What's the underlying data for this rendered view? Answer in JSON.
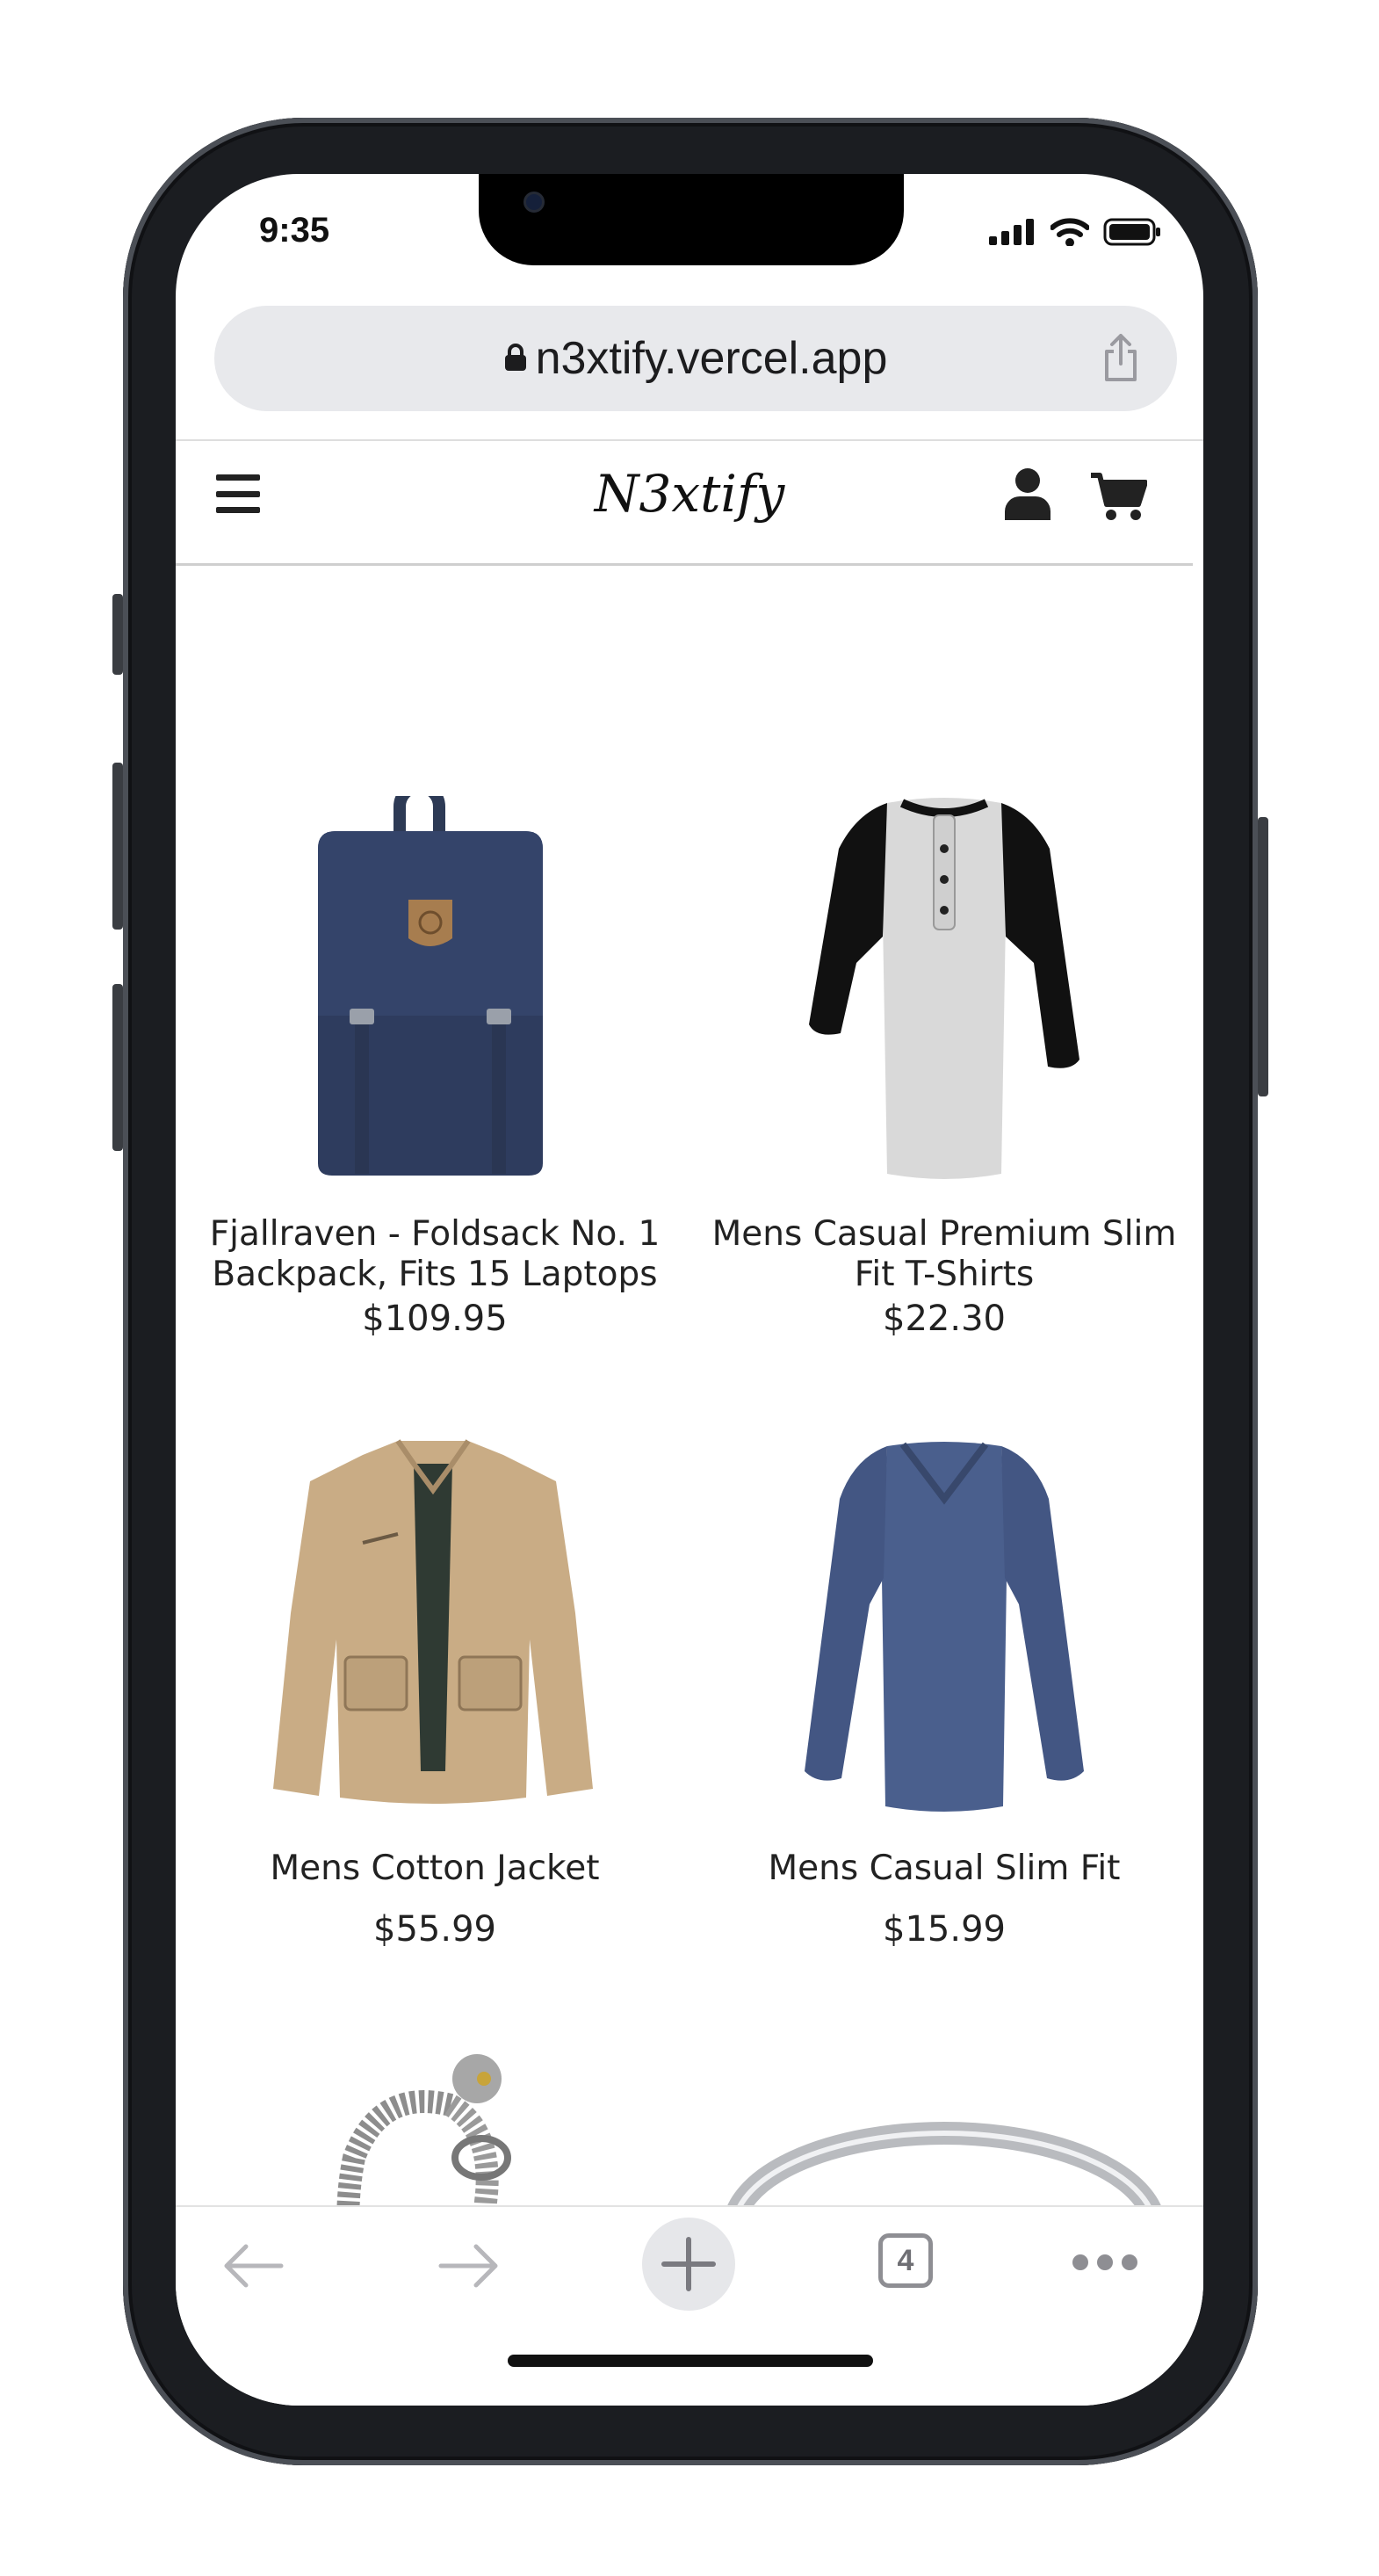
{
  "status": {
    "time": "9:35"
  },
  "browser": {
    "url": "n3xtify.vercel.app",
    "tab_count": "4"
  },
  "site": {
    "logo": "N3xtify"
  },
  "products": [
    {
      "title": "Fjallraven - Foldsack No. 1 Backpack, Fits 15 Laptops",
      "price": "$109.95",
      "image": "backpack"
    },
    {
      "title": "Mens Casual Premium Slim Fit T-Shirts",
      "price": "$22.30",
      "image": "raglan-shirt"
    },
    {
      "title": "Mens Cotton Jacket",
      "price": "$55.99",
      "image": "jacket"
    },
    {
      "title": "Mens Casual Slim Fit",
      "price": "$15.99",
      "image": "long-sleeve-shirt"
    },
    {
      "title": "",
      "price": "",
      "image": "dragon-bracelet"
    },
    {
      "title": "",
      "price": "",
      "image": "silver-ring"
    }
  ],
  "colors": {
    "background": "#ffffff",
    "url_bar": "#e8e9ec",
    "text": "#222222",
    "toolbar_icon": "#8e8e93"
  },
  "icons": [
    "lock-icon",
    "share-icon",
    "hamburger-icon",
    "user-icon",
    "cart-icon",
    "back-arrow-icon",
    "forward-arrow-icon",
    "plus-icon",
    "tabs-icon",
    "more-icon"
  ]
}
